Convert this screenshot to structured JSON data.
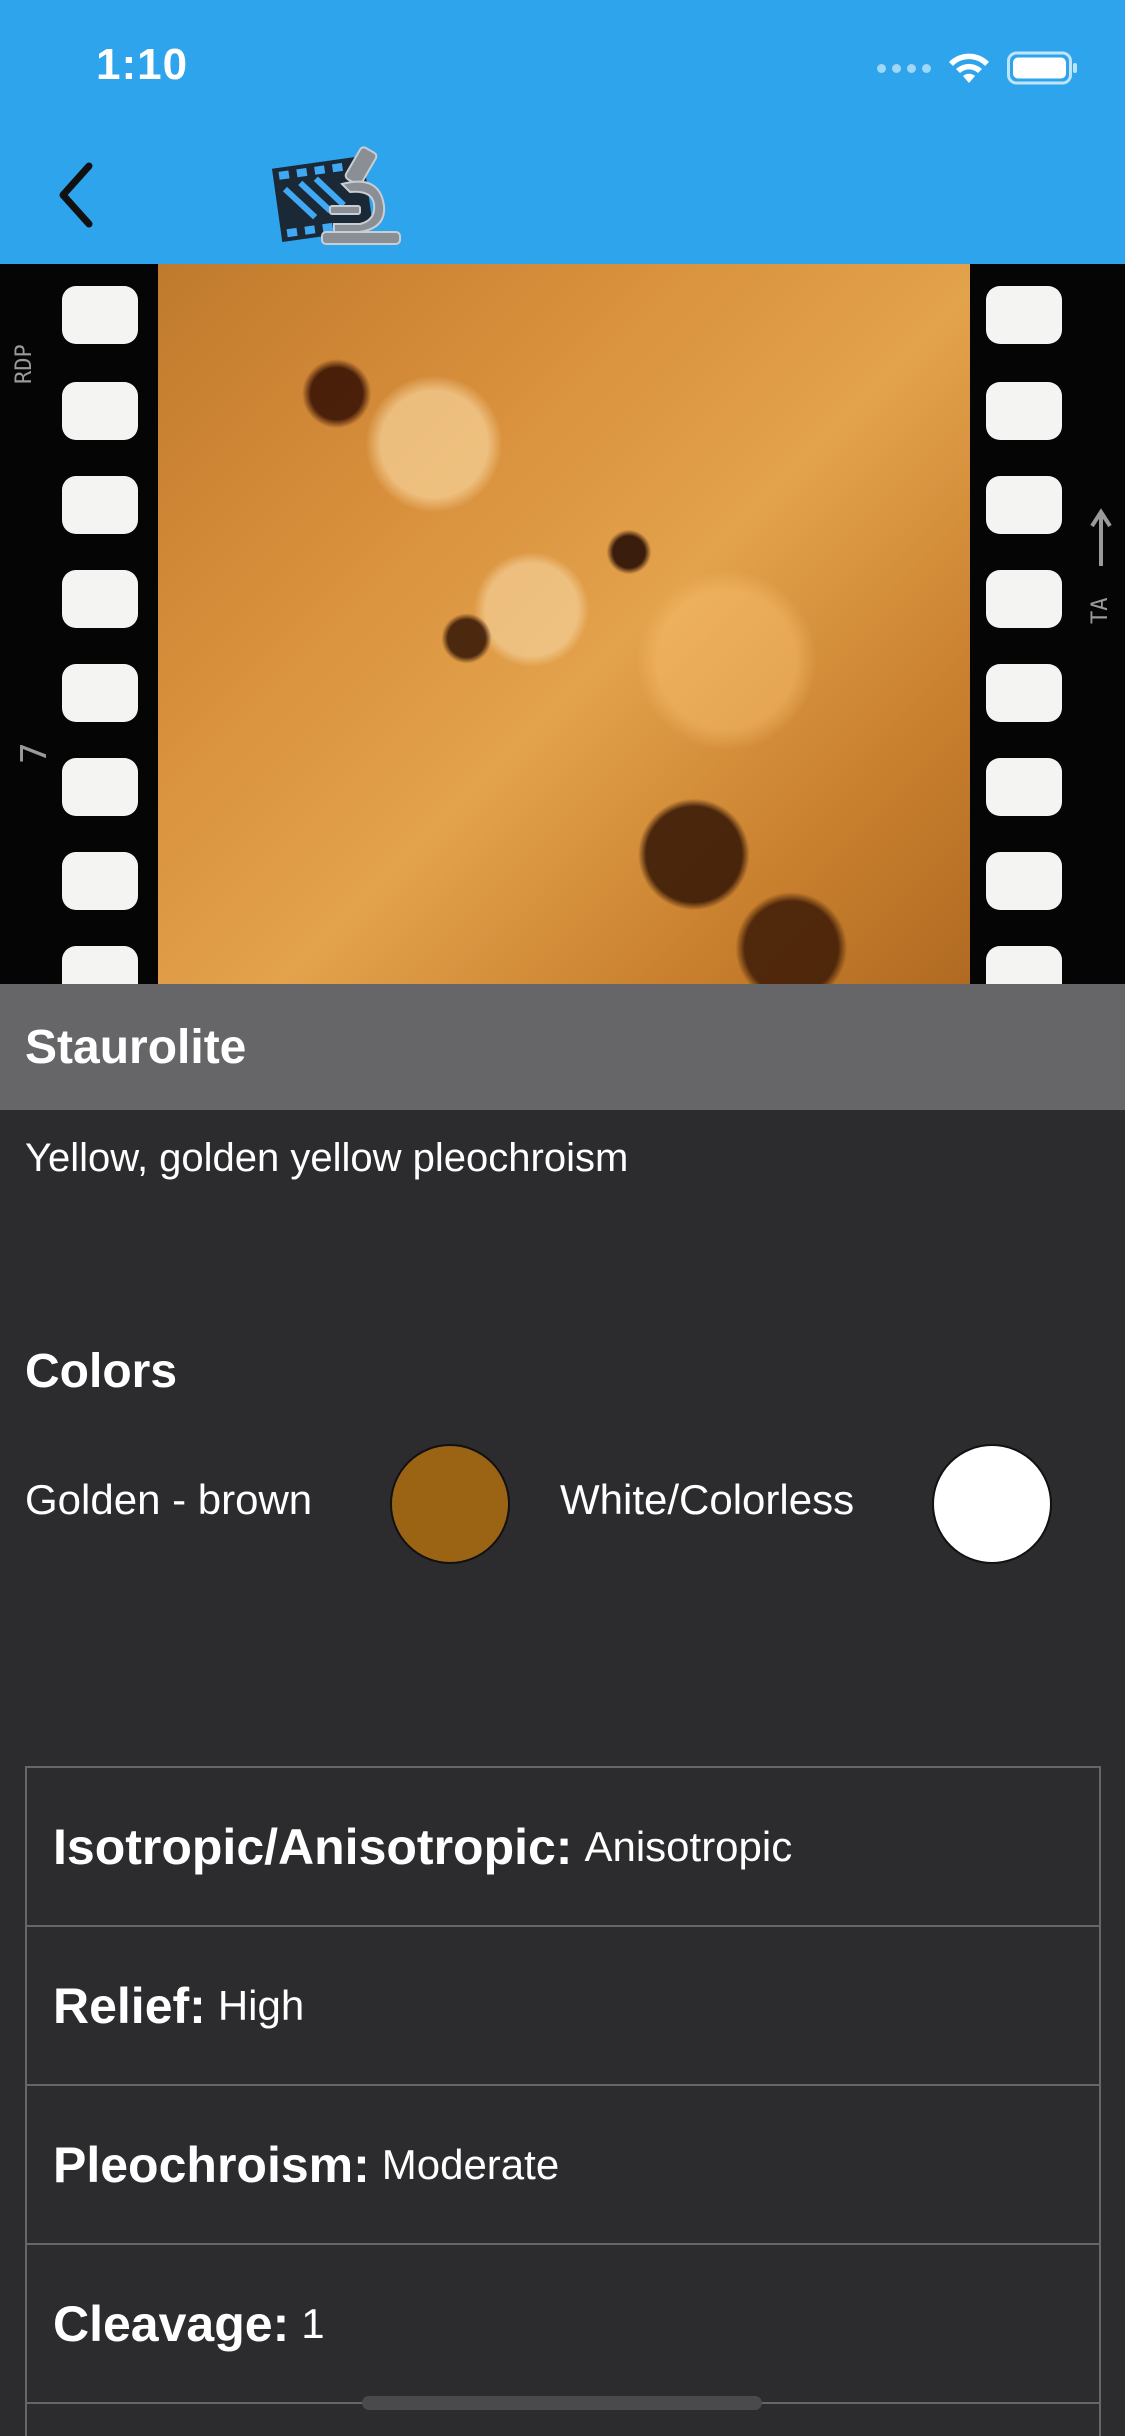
{
  "status_bar": {
    "time": "1:10",
    "wifi_icon": "wifi-icon",
    "battery_icon": "battery-icon"
  },
  "nav": {
    "back_icon": "chevron-left-icon",
    "logo_icon": "film-microscope-logo"
  },
  "photo": {
    "alt": "Staurolite thin section",
    "film_marks": {
      "left_top": "RDP",
      "left_mid": "7",
      "right_mid": "TA"
    }
  },
  "mineral": {
    "name": "Staurolite",
    "description": "Yellow, golden yellow pleochroism"
  },
  "colors": {
    "heading": "Colors",
    "items": [
      {
        "label": "Golden - brown",
        "hex": "#9b6415"
      },
      {
        "label": "White/Colorless",
        "hex": "#ffffff"
      }
    ]
  },
  "properties": [
    {
      "key": "Isotropic/Anisotropic:",
      "value": "Anisotropic"
    },
    {
      "key": "Relief:",
      "value": "High"
    },
    {
      "key": "Pleochroism:",
      "value": "Moderate"
    },
    {
      "key": "Cleavage:",
      "value": "1"
    }
  ],
  "theme": {
    "header": "#2ea4ec",
    "background": "#2c2c2e",
    "title_bar": "#666668"
  }
}
